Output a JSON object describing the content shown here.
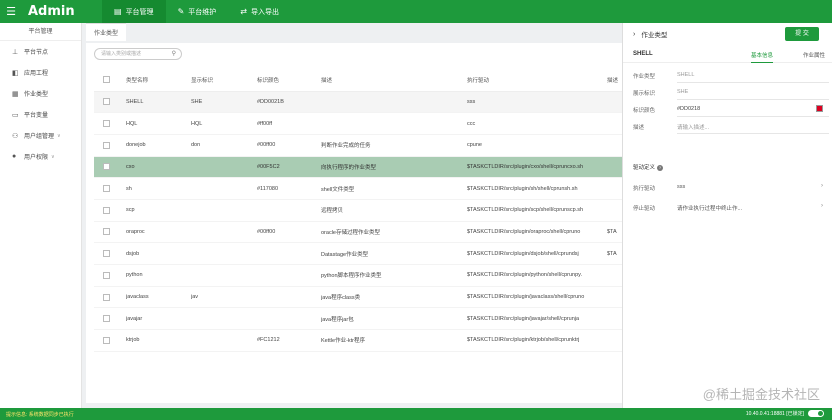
{
  "topbar": {
    "brand": "Admin",
    "nav": [
      {
        "label": "平台管理",
        "icon": "list-icon",
        "active": true
      },
      {
        "label": "平台维护",
        "icon": "wrench-icon",
        "active": false
      },
      {
        "label": "导入导出",
        "icon": "transfer-icon",
        "active": false
      }
    ]
  },
  "sidebar": {
    "title": "平台管理",
    "items": [
      {
        "label": "平台节点",
        "icon": "sitemap-icon",
        "expandable": false
      },
      {
        "label": "应用工程",
        "icon": "project-icon",
        "expandable": false
      },
      {
        "label": "作业类型",
        "icon": "grid-icon",
        "expandable": false
      },
      {
        "label": "平台变量",
        "icon": "variable-icon",
        "expandable": false
      },
      {
        "label": "用户组管理",
        "icon": "group-icon",
        "expandable": true
      },
      {
        "label": "用户权限",
        "icon": "user-icon",
        "expandable": true
      }
    ]
  },
  "tab": {
    "label": "作业类型"
  },
  "search": {
    "placeholder": "请输入类别或描述"
  },
  "table": {
    "columns": [
      "类型名称",
      "显示标识",
      "标识颜色",
      "描述",
      "执行驱动",
      "描述"
    ],
    "rows": [
      {
        "name": "SHELL",
        "id": "SHE",
        "color": "#DD0021B",
        "desc": "",
        "driver": "sss",
        "extra": "",
        "state": "hover"
      },
      {
        "name": "HQL",
        "id": "HQL",
        "color": "#ff00ff",
        "desc": "",
        "driver": "ccc",
        "extra": "",
        "state": ""
      },
      {
        "name": "donejob",
        "id": "don",
        "color": "#00ff00",
        "desc": "判断作业完成的任务",
        "driver": "cpune",
        "extra": "",
        "state": ""
      },
      {
        "name": "cxo",
        "id": "",
        "color": "#00F5C2",
        "desc": "向执行程序的作业类型",
        "driver": "$TASKCTLDIR/src/plugin/cxo/shell/cpruncxo.sh",
        "extra": "",
        "state": "sel"
      },
      {
        "name": "sh",
        "id": "",
        "color": "#117080",
        "desc": "shell文件类型",
        "driver": "$TASKCTLDIR/src/plugin/sh/shell/cprunsh.sh",
        "extra": "",
        "state": ""
      },
      {
        "name": "scp",
        "id": "",
        "color": "",
        "desc": "远程拷贝",
        "driver": "$TASKCTLDIR/src/plugin/scp/shell/cprunscp.sh",
        "extra": "",
        "state": ""
      },
      {
        "name": "oraproc",
        "id": "",
        "color": "#00ff00",
        "desc": "oracle存储过程作业类型",
        "driver": "$TASKCTLDIR/src/plugin/oraproc/shell/cpruno",
        "extra": "$TA",
        "state": ""
      },
      {
        "name": "dsjob",
        "id": "",
        "color": "",
        "desc": "Datastage作业类型",
        "driver": "$TASKCTLDIR/src/plugin/dsjob/shell/cprundsj",
        "extra": "$TA",
        "state": ""
      },
      {
        "name": "python",
        "id": "",
        "color": "",
        "desc": "python脚本程序作业类型",
        "driver": "$TASKCTLDIR/src/plugin/python/shell/cprunpy.",
        "extra": "",
        "state": ""
      },
      {
        "name": "javaclass",
        "id": "jav",
        "color": "",
        "desc": "java程序class类",
        "driver": "$TASKCTLDIR/src/plugin/javaclass/shell/cpruno",
        "extra": "",
        "state": ""
      },
      {
        "name": "javajar",
        "id": "",
        "color": "",
        "desc": "java程序jar包",
        "driver": "$TASKCTLDIR/src/plugin/javajar/shell/cprunja",
        "extra": "",
        "state": ""
      },
      {
        "name": "ktrjob",
        "id": "",
        "color": "#FC1212",
        "desc": "Kettle作业-ktr程序",
        "driver": "$TASKCTLDIR/src/plugin/ktrjob/shell/cprunktrj",
        "extra": "",
        "state": ""
      }
    ]
  },
  "panel": {
    "title": "作业类型",
    "submit_label": "提 交",
    "name": "SHELL",
    "tab_basic": "基本信息",
    "tab_props": "作业属性",
    "fields": [
      {
        "label": "作业类型",
        "value": "SHELL"
      },
      {
        "label": "展示标识",
        "value": "SHE"
      },
      {
        "label": "标识颜色",
        "value": "#DD0218"
      },
      {
        "label": "描述",
        "value": "请输入描述..."
      }
    ],
    "section_title": "驱动定义",
    "drivers": [
      {
        "label": "执行驱动",
        "value": "sss"
      },
      {
        "label": "停止驱动",
        "value": "请作业执行过程中终止作..."
      }
    ]
  },
  "status": {
    "left": "提示信息: 系统数据同步已执行",
    "right": "10.40.0.41:18881 [已锁定]"
  },
  "watermark": "@稀土掘金技术社区",
  "colors": {
    "accent": "#1e9a3c",
    "selected_row": "#a9ccb3",
    "swatch": "#dd0021"
  }
}
